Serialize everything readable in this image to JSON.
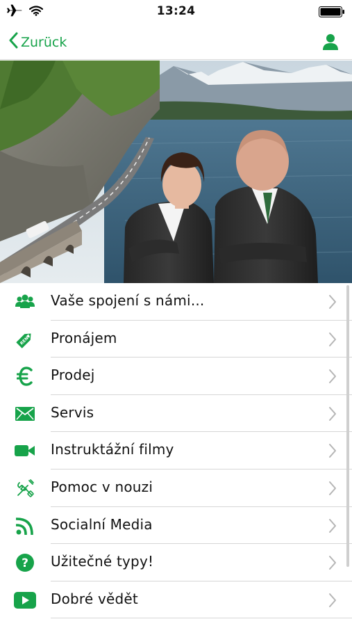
{
  "status_bar": {
    "time": "13:24",
    "icons": [
      "airplane-icon",
      "wifi-icon",
      "battery-icon"
    ]
  },
  "nav": {
    "back_label": "Zurück",
    "user_icon": "user-icon"
  },
  "colors": {
    "accent": "#17a34a",
    "divider": "#d6d6d6",
    "chevron": "#b5b5b5"
  },
  "hero": {
    "description_icon": "hero-photo"
  },
  "menu": {
    "items": [
      {
        "label": "Vaše spojení s námi...",
        "icon": "group-icon"
      },
      {
        "label": "Pronájem",
        "icon": "rent-tag-icon"
      },
      {
        "label": "Prodej",
        "icon": "euro-icon"
      },
      {
        "label": "Servis",
        "icon": "envelope-icon"
      },
      {
        "label": "Instruktážní filmy",
        "icon": "video-camera-icon"
      },
      {
        "label": "Pomoc v nouzi",
        "icon": "tools-icon"
      },
      {
        "label": "Socialní Media",
        "icon": "rss-icon"
      },
      {
        "label": "Užitečné typy!",
        "icon": "question-icon"
      },
      {
        "label": "Dobré vědět",
        "icon": "play-icon"
      }
    ]
  }
}
